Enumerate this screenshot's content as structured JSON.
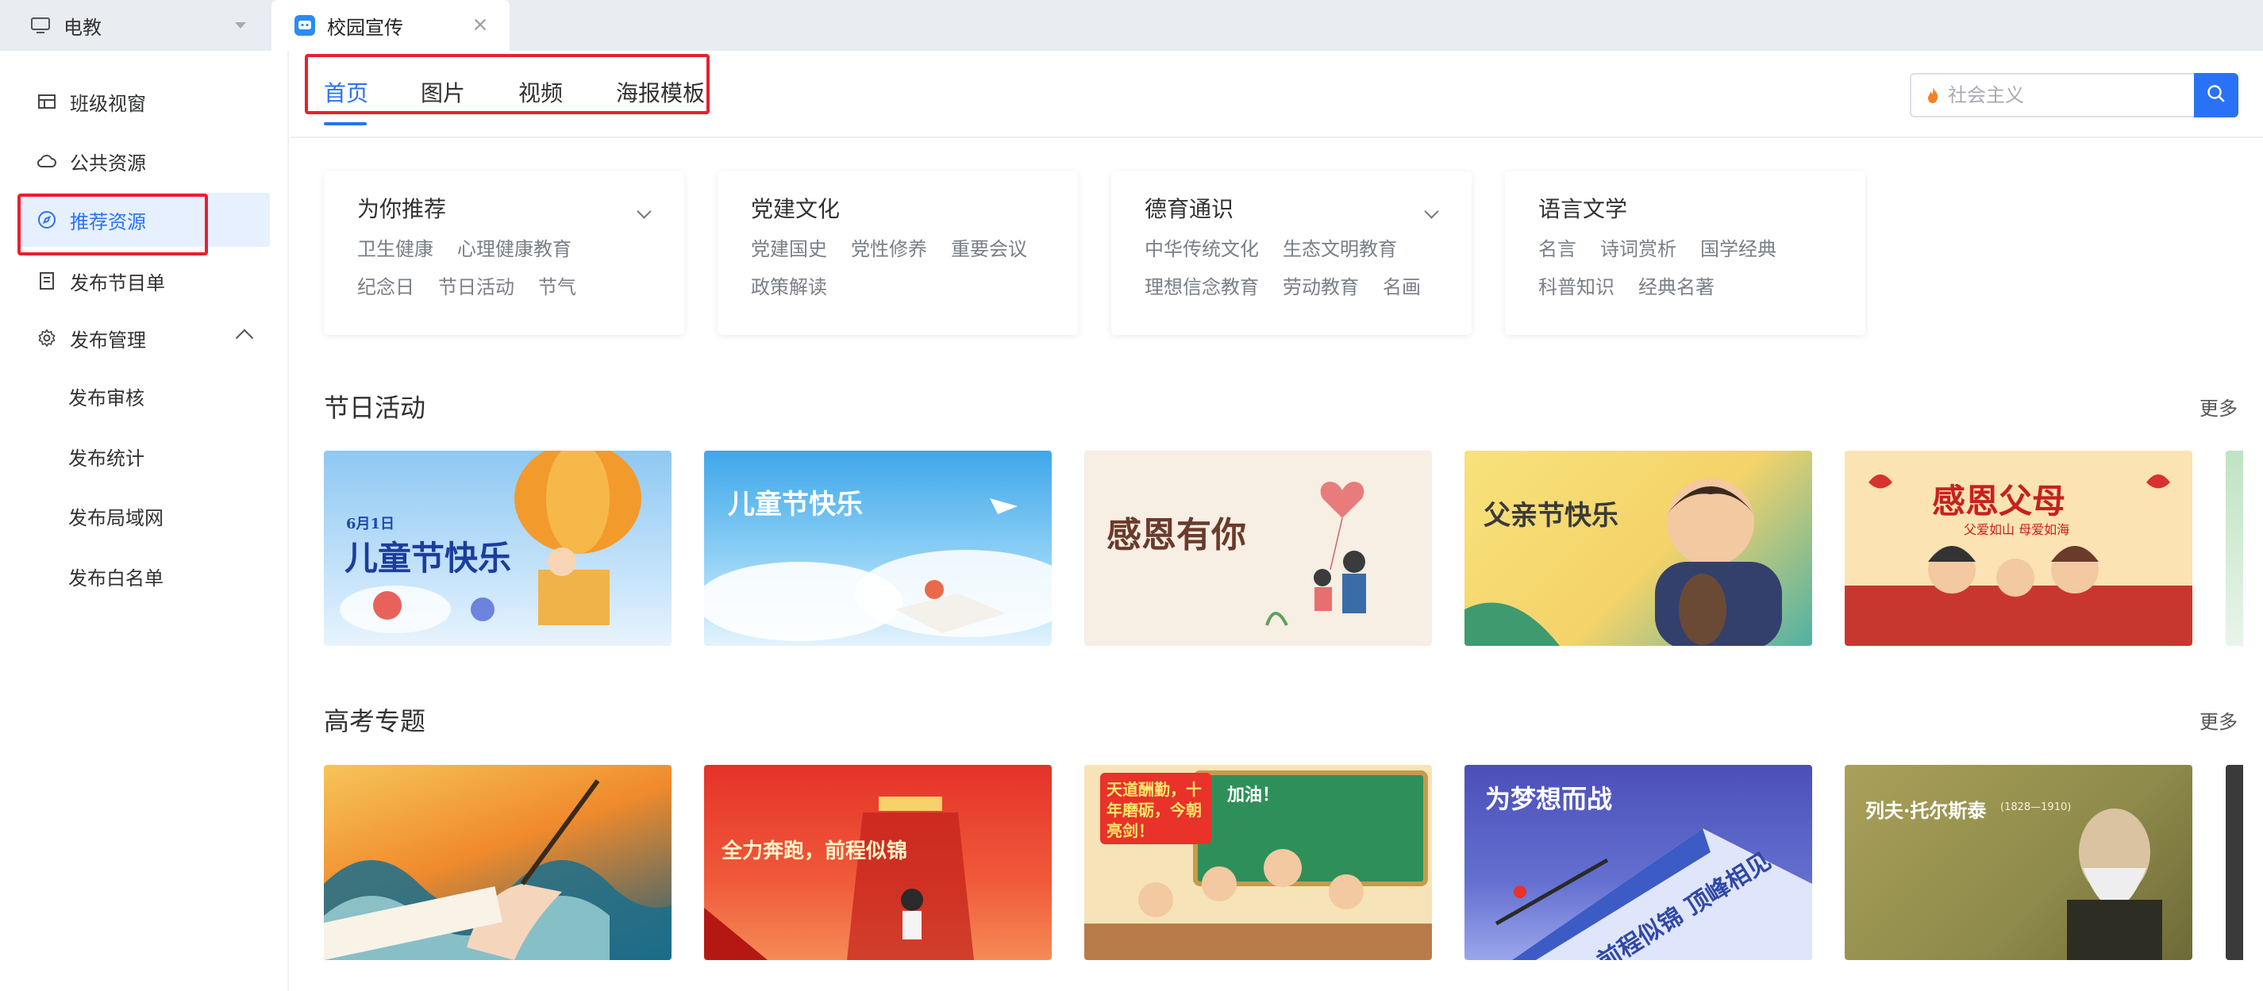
{
  "topbar": {
    "app_name": "电教",
    "doc_tab_title": "校园宣传"
  },
  "sidebar": {
    "items": [
      {
        "label": "班级视窗",
        "icon": "layout-icon"
      },
      {
        "label": "公共资源",
        "icon": "cloud-icon"
      },
      {
        "label": "推荐资源",
        "icon": "compass-icon",
        "active": true
      },
      {
        "label": "发布节目单",
        "icon": "list-doc-icon"
      },
      {
        "label": "发布管理",
        "icon": "gear-icon",
        "expanded": true
      }
    ],
    "sub_items": [
      "发布审核",
      "发布统计",
      "发布局域网",
      "发布白名单"
    ]
  },
  "content_tabs": [
    {
      "label": "首页",
      "active": true
    },
    {
      "label": "图片"
    },
    {
      "label": "视频"
    },
    {
      "label": "海报模板"
    }
  ],
  "search": {
    "placeholder": "社会主义"
  },
  "categories": [
    {
      "title": "为你推荐",
      "has_dropdown": true,
      "row1": [
        "卫生健康",
        "心理健康教育"
      ],
      "row2": [
        "纪念日",
        "节日活动",
        "节气"
      ]
    },
    {
      "title": "党建文化",
      "has_dropdown": false,
      "row1": [
        "党建国史",
        "党性修养",
        "重要会议"
      ],
      "row2": [
        "政策解读"
      ]
    },
    {
      "title": "德育通识",
      "has_dropdown": true,
      "row1": [
        "中华传统文化",
        "生态文明教育"
      ],
      "row2": [
        "理想信念教育",
        "劳动教育",
        "名画"
      ]
    },
    {
      "title": "语言文学",
      "has_dropdown": false,
      "row1": [
        "名言",
        "诗词赏析",
        "国学经典"
      ],
      "row2": [
        "科普知识",
        "经典名著"
      ]
    }
  ],
  "sections": [
    {
      "title": "节日活动",
      "more": "更多",
      "thumbs": [
        {
          "main": "儿童节快乐",
          "top": "6月1日"
        },
        {
          "main": "儿童节快乐"
        },
        {
          "main": "感恩有你"
        },
        {
          "main": "父亲节快乐"
        },
        {
          "main": "感恩父母",
          "sub": "父爱如山 母爱如海"
        }
      ]
    },
    {
      "title": "高考专题",
      "more": "更多",
      "thumbs": [
        {
          "main": ""
        },
        {
          "main": "全力奔跑，前程似锦"
        },
        {
          "main": "天道酬勤，十年磨砺，今朝亮剑！",
          "top": "加油！"
        },
        {
          "main": "为梦想而战",
          "sub": "前程似锦 顶峰相见"
        },
        {
          "main": "列夫·托尔斯泰",
          "top": "(1828—1910)"
        }
      ]
    }
  ],
  "colors": {
    "accent": "#2a72f5",
    "highlight_box": "#e8202e",
    "active_bg": "#e6f0ff"
  }
}
